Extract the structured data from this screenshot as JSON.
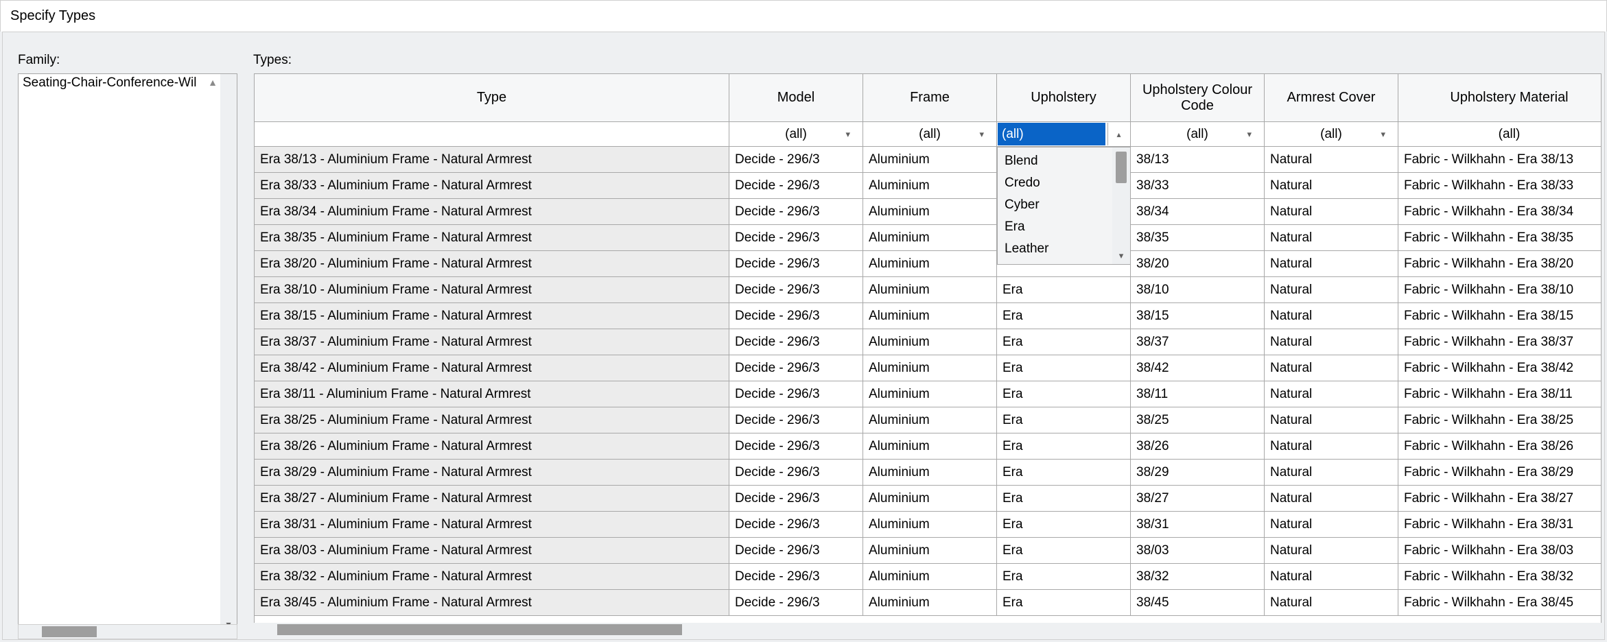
{
  "window": {
    "title": "Specify Types"
  },
  "labels": {
    "family": "Family:",
    "types": "Types:"
  },
  "family_list": {
    "items": [
      "Seating-Chair-Conference-Wil"
    ]
  },
  "columns": [
    {
      "key": "type",
      "label": "Type",
      "cls": "col-type",
      "filter": ""
    },
    {
      "key": "model",
      "label": "Model",
      "cls": "col-model",
      "filter": "(all)"
    },
    {
      "key": "frame",
      "label": "Frame",
      "cls": "col-frame",
      "filter": "(all)"
    },
    {
      "key": "uph",
      "label": "Upholstery",
      "cls": "col-uph",
      "filter": "(all)",
      "active": true
    },
    {
      "key": "code",
      "label": "Upholstery Colour Code",
      "cls": "col-code",
      "filter": "(all)"
    },
    {
      "key": "arm",
      "label": "Armrest Cover",
      "cls": "col-arm",
      "filter": "(all)"
    },
    {
      "key": "mat",
      "label": "Upholstery Material",
      "cls": "col-mat",
      "filter": "(all)"
    }
  ],
  "upholstery_dropdown": {
    "selected": "(all)",
    "options": [
      "Blend",
      "Credo",
      "Cyber",
      "Era",
      "Leather"
    ]
  },
  "rows": [
    {
      "type": "Era 38/13 - Aluminium Frame - Natural Armrest",
      "model": "Decide - 296/3",
      "frame": "Aluminium",
      "uph": "",
      "code": "38/13",
      "arm": "Natural",
      "mat": "Fabric - Wilkhahn - Era 38/13"
    },
    {
      "type": "Era 38/33 - Aluminium Frame - Natural Armrest",
      "model": "Decide - 296/3",
      "frame": "Aluminium",
      "uph": "",
      "code": "38/33",
      "arm": "Natural",
      "mat": "Fabric - Wilkhahn - Era 38/33"
    },
    {
      "type": "Era 38/34 - Aluminium Frame - Natural Armrest",
      "model": "Decide - 296/3",
      "frame": "Aluminium",
      "uph": "",
      "code": "38/34",
      "arm": "Natural",
      "mat": "Fabric - Wilkhahn - Era 38/34"
    },
    {
      "type": "Era 38/35 - Aluminium Frame - Natural Armrest",
      "model": "Decide - 296/3",
      "frame": "Aluminium",
      "uph": "",
      "code": "38/35",
      "arm": "Natural",
      "mat": "Fabric - Wilkhahn - Era 38/35"
    },
    {
      "type": "Era 38/20 - Aluminium Frame - Natural Armrest",
      "model": "Decide - 296/3",
      "frame": "Aluminium",
      "uph": "",
      "code": "38/20",
      "arm": "Natural",
      "mat": "Fabric - Wilkhahn - Era 38/20"
    },
    {
      "type": "Era 38/10 - Aluminium Frame - Natural Armrest",
      "model": "Decide - 296/3",
      "frame": "Aluminium",
      "uph": "Era",
      "code": "38/10",
      "arm": "Natural",
      "mat": "Fabric - Wilkhahn - Era 38/10"
    },
    {
      "type": "Era 38/15 - Aluminium Frame - Natural Armrest",
      "model": "Decide - 296/3",
      "frame": "Aluminium",
      "uph": "Era",
      "code": "38/15",
      "arm": "Natural",
      "mat": "Fabric - Wilkhahn - Era 38/15"
    },
    {
      "type": "Era 38/37 - Aluminium Frame - Natural Armrest",
      "model": "Decide - 296/3",
      "frame": "Aluminium",
      "uph": "Era",
      "code": "38/37",
      "arm": "Natural",
      "mat": "Fabric - Wilkhahn - Era 38/37"
    },
    {
      "type": "Era 38/42 - Aluminium Frame - Natural Armrest",
      "model": "Decide - 296/3",
      "frame": "Aluminium",
      "uph": "Era",
      "code": "38/42",
      "arm": "Natural",
      "mat": "Fabric - Wilkhahn - Era 38/42"
    },
    {
      "type": "Era 38/11 - Aluminium Frame - Natural Armrest",
      "model": "Decide - 296/3",
      "frame": "Aluminium",
      "uph": "Era",
      "code": "38/11",
      "arm": "Natural",
      "mat": "Fabric - Wilkhahn - Era 38/11"
    },
    {
      "type": "Era 38/25 - Aluminium Frame - Natural Armrest",
      "model": "Decide - 296/3",
      "frame": "Aluminium",
      "uph": "Era",
      "code": "38/25",
      "arm": "Natural",
      "mat": "Fabric - Wilkhahn - Era 38/25"
    },
    {
      "type": "Era 38/26 - Aluminium Frame - Natural Armrest",
      "model": "Decide - 296/3",
      "frame": "Aluminium",
      "uph": "Era",
      "code": "38/26",
      "arm": "Natural",
      "mat": "Fabric - Wilkhahn - Era 38/26"
    },
    {
      "type": "Era 38/29 - Aluminium Frame - Natural Armrest",
      "model": "Decide - 296/3",
      "frame": "Aluminium",
      "uph": "Era",
      "code": "38/29",
      "arm": "Natural",
      "mat": "Fabric - Wilkhahn - Era 38/29"
    },
    {
      "type": "Era 38/27 - Aluminium Frame - Natural Armrest",
      "model": "Decide - 296/3",
      "frame": "Aluminium",
      "uph": "Era",
      "code": "38/27",
      "arm": "Natural",
      "mat": "Fabric - Wilkhahn - Era 38/27"
    },
    {
      "type": "Era 38/31 - Aluminium Frame - Natural Armrest",
      "model": "Decide - 296/3",
      "frame": "Aluminium",
      "uph": "Era",
      "code": "38/31",
      "arm": "Natural",
      "mat": "Fabric - Wilkhahn - Era 38/31"
    },
    {
      "type": "Era 38/03 - Aluminium Frame - Natural Armrest",
      "model": "Decide - 296/3",
      "frame": "Aluminium",
      "uph": "Era",
      "code": "38/03",
      "arm": "Natural",
      "mat": "Fabric - Wilkhahn - Era 38/03"
    },
    {
      "type": "Era 38/32 - Aluminium Frame - Natural Armrest",
      "model": "Decide - 296/3",
      "frame": "Aluminium",
      "uph": "Era",
      "code": "38/32",
      "arm": "Natural",
      "mat": "Fabric - Wilkhahn - Era 38/32"
    },
    {
      "type": "Era 38/45 - Aluminium Frame - Natural Armrest",
      "model": "Decide - 296/3",
      "frame": "Aluminium",
      "uph": "Era",
      "code": "38/45",
      "arm": "Natural",
      "mat": "Fabric - Wilkhahn - Era 38/45"
    }
  ]
}
